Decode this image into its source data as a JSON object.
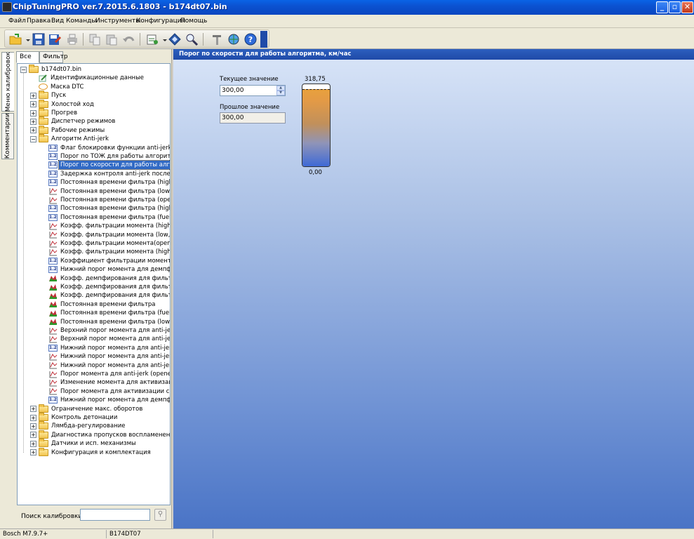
{
  "window": {
    "title": "ChipTuningPRO ver.7.2015.6.1803 - b174dt07.bin"
  },
  "menu": [
    "Файл",
    "Правка",
    "Вид",
    "Команды",
    "Инструменты",
    "Конфигурация",
    "Помощь"
  ],
  "toolbar": {
    "icons": [
      "open-folder-icon",
      "save-icon",
      "save-edit-icon",
      "print-icon",
      "copy-icon",
      "paste-icon",
      "undo-icon",
      "checksum-icon",
      "diamond-icon",
      "search-binary-icon",
      "tools-icon",
      "globe-icon",
      "help-icon"
    ]
  },
  "side_tabs": [
    "Меню калибровок",
    "Комментарии"
  ],
  "panel_tabs": [
    "Все",
    "Фильтр"
  ],
  "tree": {
    "root": "b174dt07.bin",
    "root_children": [
      {
        "label": "Идентификационные данные",
        "icon": "pencil-icon"
      },
      {
        "label": "Маска DTC",
        "icon": "mask-icon"
      }
    ],
    "folders_before": [
      "Пуск",
      "Холостой ход",
      "Прогрев",
      "Диспетчер режимов",
      "Рабочие режимы"
    ],
    "open_folder": "Алгоритм Anti-jerk",
    "items": [
      {
        "label": "Флаг блокировки функции anti-jerk",
        "icon": "scalar-icon"
      },
      {
        "label": "Порог по ТОЖ для работы алгоритма",
        "icon": "scalar-icon"
      },
      {
        "label": "Порог по скорости для работы алгоритма",
        "icon": "scalar-icon",
        "selected": true
      },
      {
        "label": "Задержка контроля anti-jerk после возо",
        "icon": "scalar-icon"
      },
      {
        "label": "Постоянная времени фильтра (high, ope",
        "icon": "scalar-icon"
      },
      {
        "label": "Постоянная времени фильтра (low, oper",
        "icon": "table-icon"
      },
      {
        "label": "Постоянная времени фильтра (opened lo",
        "icon": "table-icon"
      },
      {
        "label": "Постоянная времени фильтра (high clutc",
        "icon": "scalar-icon"
      },
      {
        "label": "Постоянная времени фильтра (fuel resta",
        "icon": "scalar-icon"
      },
      {
        "label": "Коэфф. фильтрации момента (high, oper",
        "icon": "table-icon"
      },
      {
        "label": "Коэфф. фильтрации момента (low, open",
        "icon": "table-icon"
      },
      {
        "label": "Коэфф. фильтрации момента(opened loc",
        "icon": "table-icon"
      },
      {
        "label": "Коэфф. фильтрации момента (high, close",
        "icon": "table-icon"
      },
      {
        "label": "Коэффициент фильтрации момента (fuel",
        "icon": "scalar-icon"
      },
      {
        "label": "Нижний порог момента для демпфирова",
        "icon": "scalar-icon"
      },
      {
        "label": "Коэфф. демпфирования для фильтраци",
        "icon": "map3d-icon"
      },
      {
        "label": "Коэфф. демпфирования для фильтраци",
        "icon": "map3d-icon"
      },
      {
        "label": "Коэфф. демпфирования для фильтраци",
        "icon": "map3d-icon"
      },
      {
        "label": "Постоянная времени фильтра",
        "icon": "map3d-icon"
      },
      {
        "label": "Постоянная времени фильтра (fuel resta",
        "icon": "map3d-icon"
      },
      {
        "label": "Постоянная времени фильтра (low clutch",
        "icon": "map3d-icon"
      },
      {
        "label": "Верхний порог момента для anti-jerk",
        "icon": "table-icon"
      },
      {
        "label": "Верхний порог момента для anti-jerk (op",
        "icon": "table-icon"
      },
      {
        "label": "Нижний порог момента для anti-jerk (fue",
        "icon": "scalar-icon"
      },
      {
        "label": "Нижний порог момента для anti-jerk",
        "icon": "table-icon"
      },
      {
        "label": "Нижний порог момента для anti-jerk (ope",
        "icon": "table-icon"
      },
      {
        "label": "Порог момента для anti-jerk (opened lock",
        "icon": "table-icon"
      },
      {
        "label": "Изменение момента для активизации сг",
        "icon": "table-icon"
      },
      {
        "label": "Порог момента для активизации сглажи",
        "icon": "table-icon"
      },
      {
        "label": "Нижний порог момента для демпфирова",
        "icon": "scalar-icon"
      }
    ],
    "folders_after": [
      "Ограничение макс. оборотов",
      "Контроль детонации",
      "Лямбда-регулирование",
      "Диагностика пропусков воспламенения",
      "Датчики и исп. механизмы",
      "Конфигурация и комплектация"
    ]
  },
  "search": {
    "label": "Поиск калибровки",
    "placeholder": ""
  },
  "main": {
    "header": "Порог по скорости для работы алгоритма, км/час",
    "current_label": "Текущее значение",
    "current_value": "300,00",
    "previous_label": "Прошлое значение",
    "previous_value": "300,00",
    "gauge_max": "318,75",
    "gauge_min": "0,00",
    "gauge_level": 0.9412
  },
  "status": {
    "ecu": "Bosch M7.9.7+",
    "file": "B174DT07"
  },
  "colors": {
    "accent": "#316ac5",
    "header": "#1f4aa8",
    "gauge_top": "#e8a13d",
    "gauge_bottom": "#3f6ad6"
  }
}
